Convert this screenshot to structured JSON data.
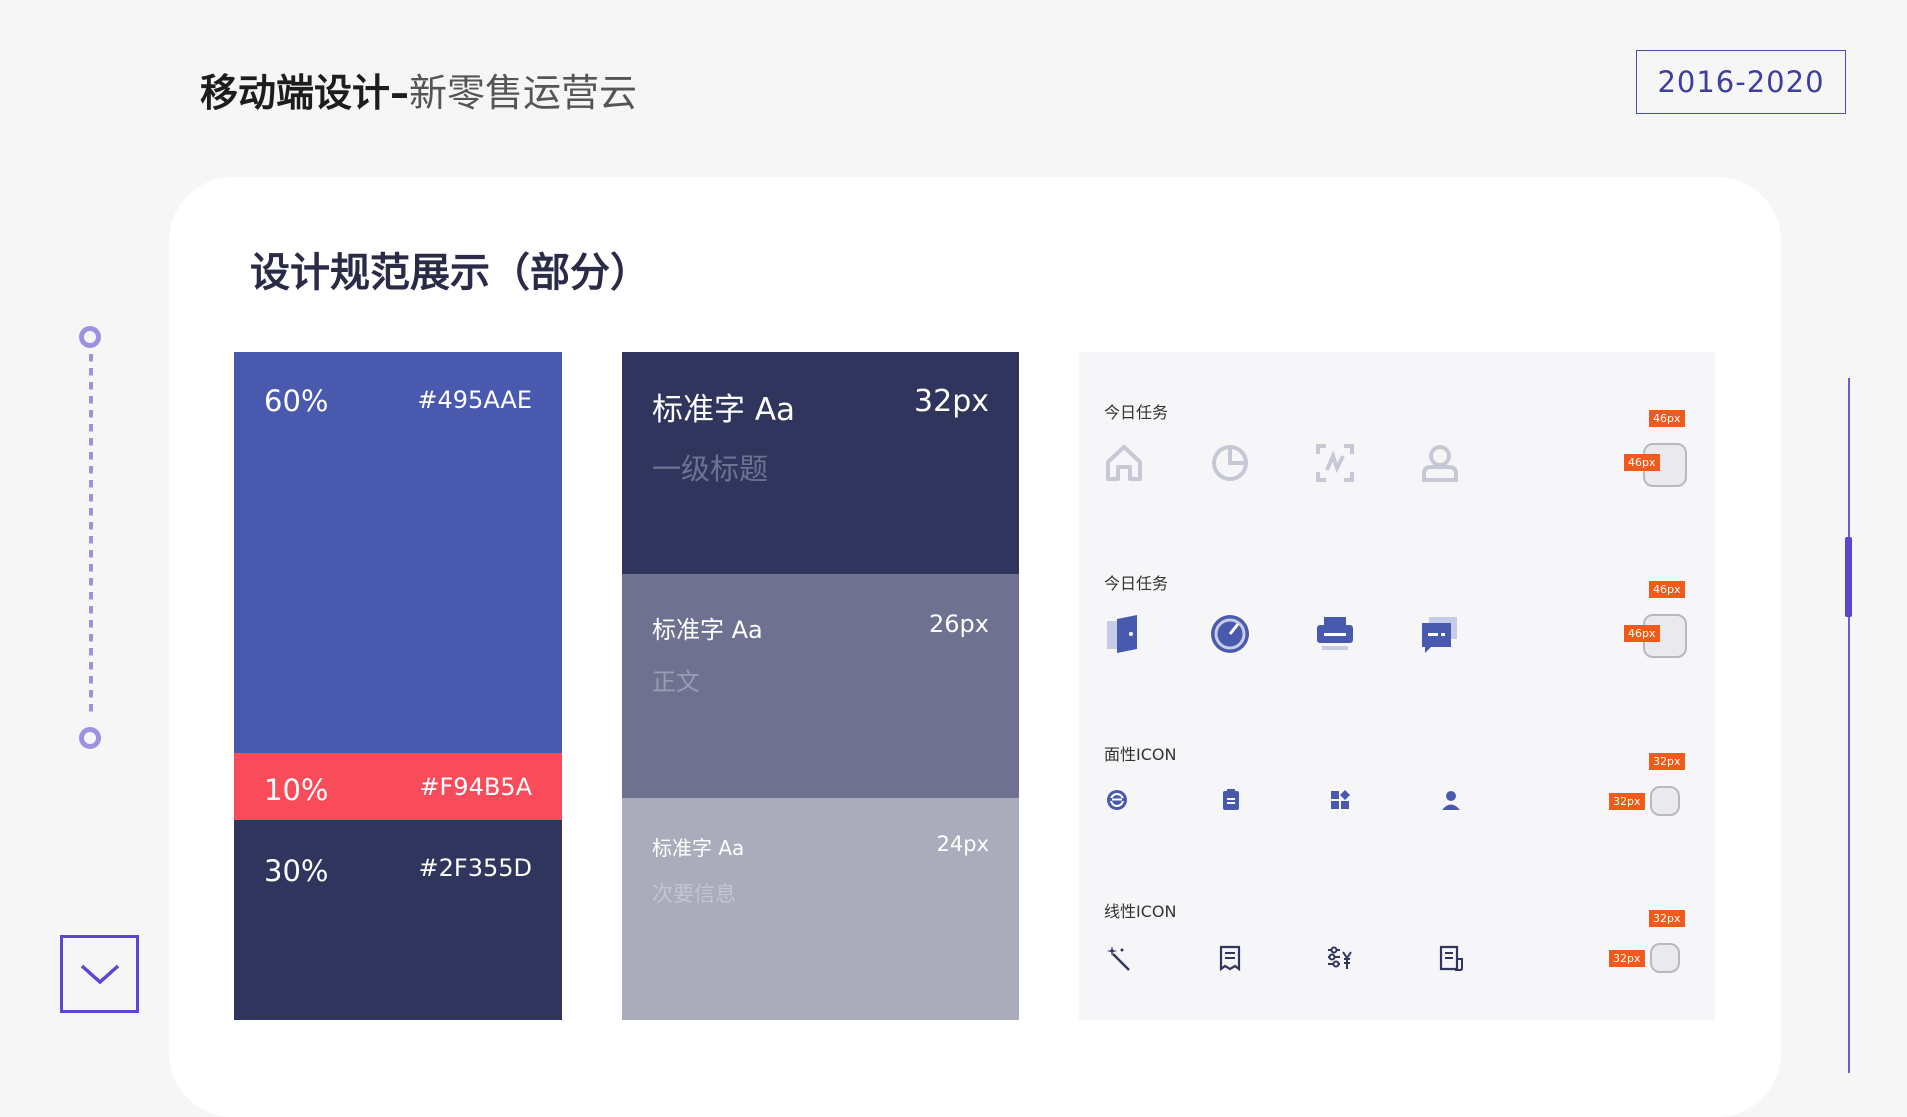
{
  "header": {
    "title_bold": "移动端设计–",
    "title_light": "新零售运营云",
    "year": "2016-2020"
  },
  "section": {
    "title": "设计规范展示（部分）"
  },
  "colors": {
    "accent": "#5b45d1",
    "timeline": "#9c93e0",
    "tag": "#f05a1a"
  },
  "palette": [
    {
      "percent": "60%",
      "hex": "#495AAE",
      "color": "#495AAE"
    },
    {
      "percent": "10%",
      "hex": "#F94B5A",
      "color": "#F94B5A"
    },
    {
      "percent": "30%",
      "hex": "#2F355D",
      "color": "#2F355D"
    }
  ],
  "typography": [
    {
      "name": "标准字 Aa",
      "size": "32px",
      "desc": "一级标题",
      "bg": "#2F355D"
    },
    {
      "name": "标准字 Aa",
      "size": "26px",
      "desc": "正文",
      "bg": "#6E7190"
    },
    {
      "name": "标准字 Aa",
      "size": "24px",
      "desc": "次要信息",
      "bg": "#AAABBB"
    }
  ],
  "icon_rows": [
    {
      "label": "今日任务",
      "icons": [
        "home-icon",
        "pie-chart-icon",
        "scan-icon",
        "user-icon"
      ],
      "spec": "46px"
    },
    {
      "label": "今日任务",
      "icons": [
        "door-icon",
        "speedometer-icon",
        "printer-icon",
        "message-card-icon"
      ],
      "spec": "46px"
    },
    {
      "label": "面性ICON",
      "icons": [
        "steering-wheel-icon",
        "clipboard-icon",
        "apps-icon",
        "person-icon"
      ],
      "spec": "32px"
    },
    {
      "label": "线性ICON",
      "icons": [
        "magic-wand-icon",
        "document-icon",
        "price-filter-icon",
        "report-icon"
      ],
      "spec": "32px"
    }
  ]
}
